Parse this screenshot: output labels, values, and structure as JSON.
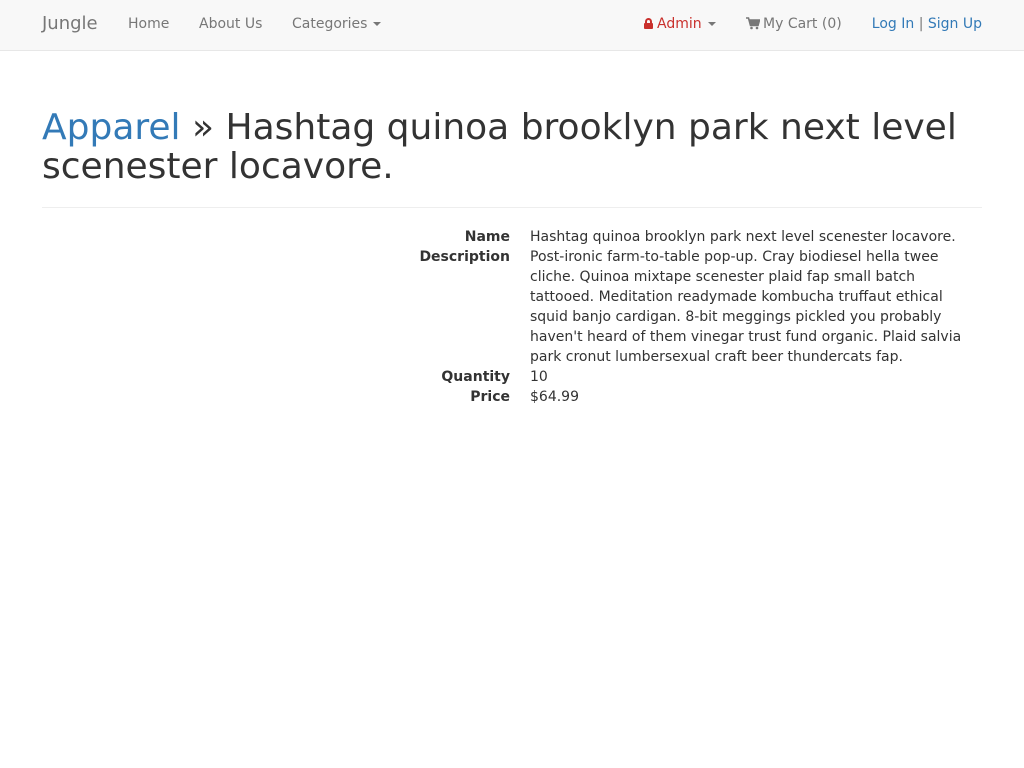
{
  "navbar": {
    "brand": "Jungle",
    "links": [
      "Home",
      "About Us"
    ],
    "categories_label": "Categories",
    "admin_label": "Admin",
    "cart_label": "My Cart (0)",
    "login_label": "Log In",
    "separator": "|",
    "signup_label": "Sign Up"
  },
  "header": {
    "category": "Apparel",
    "separator": "»",
    "product_name": "Hashtag quinoa brooklyn park next level scenester locavore."
  },
  "details": {
    "name_label": "Name",
    "name_value": "Hashtag quinoa brooklyn park next level scenester locavore.",
    "description_label": "Description",
    "description_value": "Post-ironic farm-to-table pop-up. Cray biodiesel hella twee cliche. Quinoa mixtape scenester plaid fap small batch tattooed. Meditation readymade kombucha truffaut ethical squid banjo cardigan. 8-bit meggings pickled you probably haven't heard of them vinegar trust fund organic. Plaid salvia park cronut lumbersexual craft beer thundercats fap.",
    "quantity_label": "Quantity",
    "quantity_value": "10",
    "price_label": "Price",
    "price_value": "$64.99"
  },
  "colors": {
    "link": "#337ab7",
    "nav_text": "#777777",
    "lock": "#c9302c",
    "navbar_bg": "#f8f8f8"
  }
}
